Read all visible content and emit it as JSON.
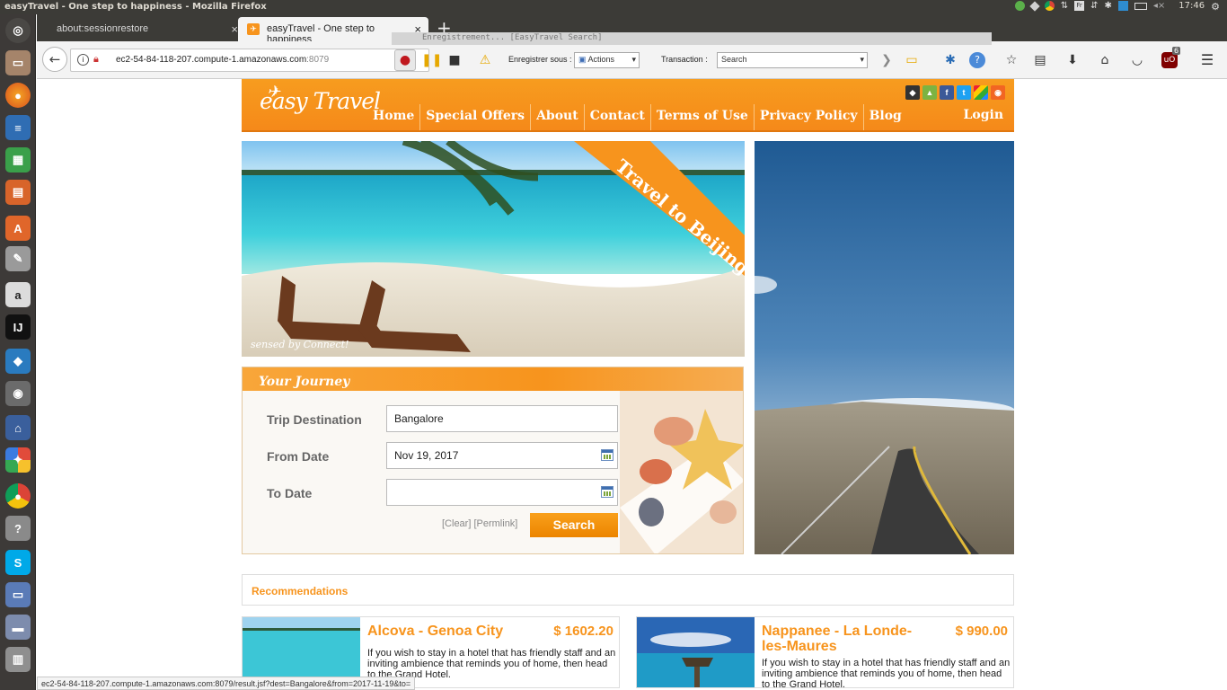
{
  "window": {
    "title": "easyTravel - One step to happiness - Mozilla Firefox",
    "clock": "17:46"
  },
  "browser": {
    "tabs": [
      {
        "label": "about:sessionrestore"
      },
      {
        "label": "easyTravel - One step to happiness"
      }
    ],
    "url_host": "ec2-54-84-118-207.compute-1.amazonaws.com",
    "url_port": ":8079",
    "recorder": {
      "panel_title": "Enregistrement... [EasyTravel Search]",
      "save_label": "Enregistrer sous :",
      "save_value": "Actions",
      "transaction_label": "Transaction :",
      "transaction_value": "Search"
    },
    "addon_badge": "6",
    "status_url": "ec2-54-84-118-207.compute-1.amazonaws.com:8079/result.jsf?dest=Bangalore&from=2017-11-19&to="
  },
  "site": {
    "logo": "easy Travel",
    "nav": [
      "Home",
      "Special Offers",
      "About",
      "Contact",
      "Terms of Use",
      "Privacy Policy",
      "Blog"
    ],
    "login": "Login",
    "banner_ribbon": "Travel to Beijing",
    "banner_credit": "sensed by Connect!",
    "journey": {
      "title": "Your Journey",
      "destination_label": "Trip Destination",
      "destination_value": "Bangalore",
      "from_label": "From Date",
      "from_value": "Nov 19, 2017",
      "to_label": "To Date",
      "to_value": "",
      "clear_link": "[Clear]",
      "permalink_link": "[Permlink]",
      "search_button": "Search"
    },
    "recommendations_title": "Recommendations",
    "cards": [
      {
        "name": "Alcova - Genoa City",
        "price": "$ 1602.20",
        "desc": "If you wish to stay in a hotel that has friendly staff and an inviting ambience that reminds you of home, then head to the Grand Hotel."
      },
      {
        "name": "Nappanee - La Londe-les-Maures",
        "price": "$ 990.00",
        "desc": "If you wish to stay in a hotel that has friendly staff and an inviting ambience that reminds you of home, then head to the Grand Hotel."
      }
    ]
  }
}
